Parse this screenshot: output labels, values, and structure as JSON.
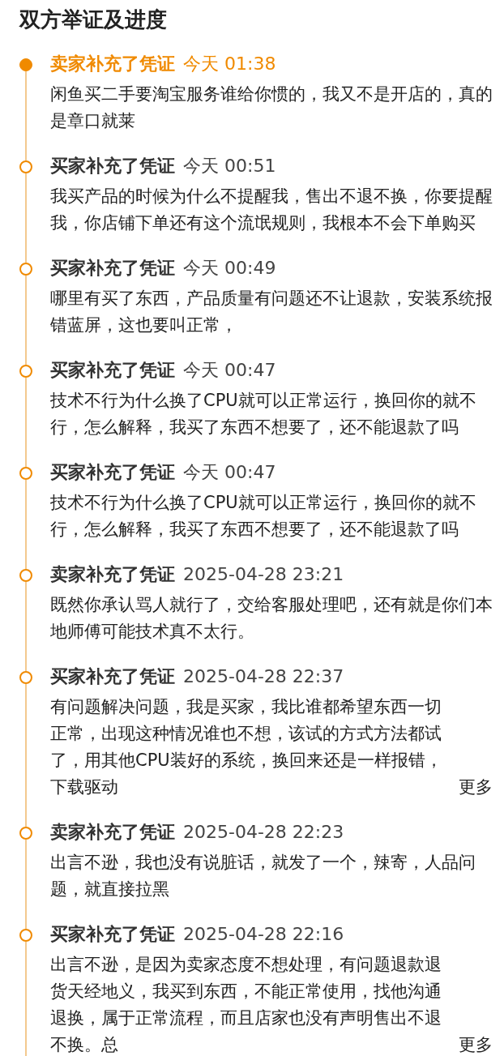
{
  "heading": "双方举证及进度",
  "events": [
    {
      "actor": "卖家补充了凭证",
      "time": "今天 01:38",
      "text": "闲鱼买二手要淘宝服务谁给你惯的，我又不是开店的，真的是章口就莱",
      "current": true
    },
    {
      "actor": "买家补充了凭证",
      "time": "今天 00:51",
      "text": "我买产品的时候为什么不提醒我，售出不退不换，你要提醒我，你店铺下单还有这个流氓规则，我根本不会下单购买",
      "current": false
    },
    {
      "actor": "买家补充了凭证",
      "time": "今天 00:49",
      "text": "哪里有买了东西，产品质量有问题还不让退款，安装系统报错蓝屏，这也要叫正常，",
      "current": false
    },
    {
      "actor": "买家补充了凭证",
      "time": "今天 00:47",
      "text": "技术不行为什么换了CPU就可以正常运行，换回你的就不行，怎么解释，我买了东西不想要了，还不能退款了吗",
      "current": false
    },
    {
      "actor": "买家补充了凭证",
      "time": "今天 00:47",
      "text": "技术不行为什么换了CPU就可以正常运行，换回你的就不行，怎么解释，我买了东西不想要了，还不能退款了吗",
      "current": false
    },
    {
      "actor": "卖家补充了凭证",
      "time": "2025-04-28 23:21",
      "text": "既然你承认骂人就行了，交给客服处理吧，还有就是你们本地师傅可能技术真不太行。",
      "current": false
    },
    {
      "actor": "买家补充了凭证",
      "time": "2025-04-28 22:37",
      "text": "有问题解决问题，我是买家，我比谁都希望东西一切正常，出现这种情况谁也不想，该试的方式方法都试了，用其他CPU装好的系统，换回来还是一样报错，下载驱动",
      "more": "更多",
      "current": false
    },
    {
      "actor": "卖家补充了凭证",
      "time": "2025-04-28 22:23",
      "text": "出言不逊，我也没有说脏话，就发了一个，辣寄，人品问题，就直接拉黑",
      "current": false
    },
    {
      "actor": "买家补充了凭证",
      "time": "2025-04-28 22:16",
      "text": "出言不逊，是因为卖家态度不想处理，有问题退款退货天经地义，我买到东西，不能正常使用，找他沟通退换，属于正常流程，而且店家也没有声明售出不退不换。总",
      "more": "更多",
      "current": false
    }
  ]
}
